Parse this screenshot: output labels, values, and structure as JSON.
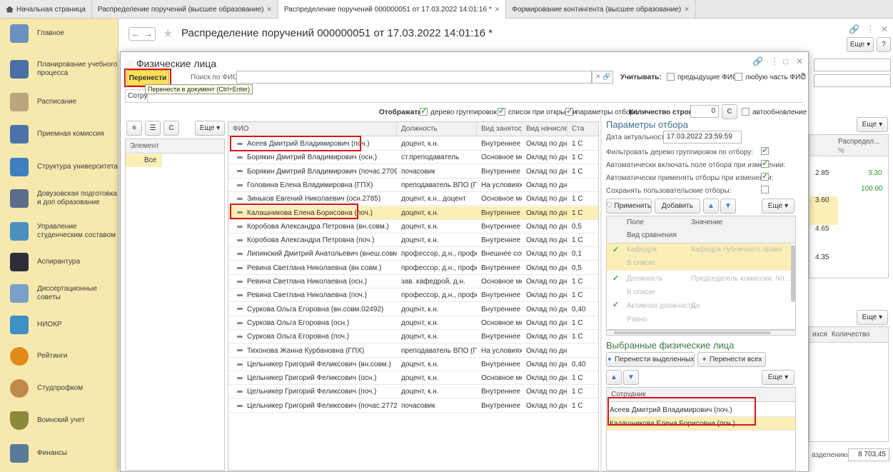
{
  "tabs": [
    {
      "label": "Начальная страница",
      "closable": false,
      "home": true
    },
    {
      "label": "Распределение поручений (высшее образование)",
      "closable": true
    },
    {
      "label": "Распределение поручений 000000051 от 17.03.2022 14:01:16 *",
      "closable": true,
      "active": true
    },
    {
      "label": "Формирование контингента (высшее образование)",
      "closable": true
    }
  ],
  "sidebar": {
    "items": [
      {
        "label": "Главное",
        "icon": "desk-icon",
        "color": "#6b8fbf"
      },
      {
        "label": "Планирование учебного процесса",
        "icon": "planner-icon",
        "color": "#4a6fa5"
      },
      {
        "label": "Расписание",
        "icon": "schedule-icon",
        "color": "#9b8a6a"
      },
      {
        "label": "Приемная комиссия",
        "icon": "admission-icon",
        "color": "#4a74a8"
      },
      {
        "label": "Структура университета",
        "icon": "structure-icon",
        "color": "#3f7fbf"
      },
      {
        "label": "Довузовская подготовка и доп образование",
        "icon": "preparation-icon",
        "color": "#5a6c8a"
      },
      {
        "label": "Управление студенческим составом",
        "icon": "students-icon",
        "color": "#4a90c0"
      },
      {
        "label": "Аспирантура",
        "icon": "graduation-icon",
        "color": "#2e2e3a"
      },
      {
        "label": "Диссертационные советы",
        "icon": "dissertation-icon",
        "color": "#7aa0c8"
      },
      {
        "label": "НИОКР",
        "icon": "research-icon",
        "color": "#3d8fc4"
      },
      {
        "label": "Рейтинги",
        "icon": "rating-icon",
        "color": "#e08a1a"
      },
      {
        "label": "Студпрофком",
        "icon": "union-icon",
        "color": "#c08a4a"
      },
      {
        "label": "Воинский учет",
        "icon": "military-icon",
        "color": "#8a8a3a"
      },
      {
        "label": "Финансы",
        "icon": "calculator-icon",
        "color": "#5a7a9a"
      }
    ]
  },
  "doc": {
    "title": "Распределение поручений 000000051 от 17.03.2022 14:01:16 *",
    "more_label": "Еще",
    "help_label": "?",
    "bg_values": [
      "2.85",
      "3.30",
      "100.00",
      "3.60",
      "4.65",
      "4.35"
    ],
    "bg_col_header": "Распредел...",
    "bg_col_unit": "%",
    "bg_col_students": "ихся",
    "bg_col_count": "Количество",
    "bg_total_label": "азделению:",
    "bg_total_value": "8 703,45"
  },
  "modal": {
    "title": "Физические лица",
    "move_btn": "Перенести",
    "tooltip": "Перенести в документ (Ctrl+Enter)",
    "search_label": "Поиск по ФИО:",
    "search_value": "",
    "consider_label": "Учитывать:",
    "opt_prev_fio": "предыдущие ФИО",
    "opt_any_part": "любую часть ФИО",
    "tab_employees": "Сотру",
    "display_label": "Отображать:",
    "opt_tree": "дерево группировок",
    "opt_list_open": "список при открытии",
    "opt_filter_params": "параметры отбора",
    "row_count_label": "Количество строк:",
    "row_count_value": "0",
    "opt_autorefresh": "автообновление",
    "more_label": "Еще",
    "tree": {
      "header": "Элемент",
      "items": [
        "Все"
      ]
    },
    "grid": {
      "columns": [
        "ФИО",
        "Должность",
        "Вид занятости",
        "Вид начислен...",
        "Ста"
      ],
      "rows": [
        {
          "fio": "Асеев Дмитрий Владимирович (поч.)",
          "pos": "доцент, к.н.",
          "emp": "Внутреннее с...",
          "acc": "Оклад по дням",
          "rate": "1 С"
        },
        {
          "fio": "Борякин Дмитрий Владимирович (осн.)",
          "pos": "ст.преподаватель",
          "emp": "Основное ме...",
          "acc": "Оклад по дням",
          "rate": "1 С"
        },
        {
          "fio": "Борякин Дмитрий Владимирович (почас.2709)",
          "pos": "почасовик",
          "emp": "Внутреннее с...",
          "acc": "Оклад по дням",
          "rate": "1 С"
        },
        {
          "fio": "Головина Елена Владимировна (ГПХ)",
          "pos": "преподаватель ВПО (ГПХ)",
          "emp": "На условиях ...",
          "acc": "Оклад по дням",
          "rate": ""
        },
        {
          "fio": "Зиньков Евгений Николаевич (осн.2785)",
          "pos": "доцент, к.н., доцент",
          "emp": "Основное ме...",
          "acc": "Оклад по дням",
          "rate": "1 С"
        },
        {
          "fio": "Калашникова Елена Борисовна (поч.)",
          "pos": "доцент, к.н.",
          "emp": "Внутреннее с...",
          "acc": "Оклад по дням",
          "rate": "1 С"
        },
        {
          "fio": "Коробова Александра Петровна (вн.совм.)",
          "pos": "доцент, к.н.",
          "emp": "Внутреннее с...",
          "acc": "Оклад по дням",
          "rate": "0,5"
        },
        {
          "fio": "Коробова Александра Петровна (поч.)",
          "pos": "доцент, к.н.",
          "emp": "Внутреннее с...",
          "acc": "Оклад по дням",
          "rate": "1 С"
        },
        {
          "fio": "Липинский Дмитрий Анатольевич (внеш.совм.)",
          "pos": "профессор, д.н., профе...",
          "emp": "Внешнее сов...",
          "acc": "Оклад по дням",
          "rate": "0,1"
        },
        {
          "fio": "Ревина Светлана Николаевна (вн.совм.)",
          "pos": "профессор, д.н., профе...",
          "emp": "Внутреннее с...",
          "acc": "Оклад по дням",
          "rate": "0,5"
        },
        {
          "fio": "Ревина Светлана Николаевна (осн.)",
          "pos": "зав. кафедрой, д.н.",
          "emp": "Основное ме...",
          "acc": "Оклад по дням",
          "rate": "1 С"
        },
        {
          "fio": "Ревина Светлана Николаевна (поч.)",
          "pos": "профессор, д.н., профе...",
          "emp": "Внутреннее с...",
          "acc": "Оклад по дням",
          "rate": "1 С"
        },
        {
          "fio": "Суркова Ольга Егоровна (вн.совм.02492)",
          "pos": "доцент, к.н.",
          "emp": "Внутреннее с...",
          "acc": "Оклад по дням",
          "rate": "0,40"
        },
        {
          "fio": "Суркова Ольга Егоровна (осн.)",
          "pos": "доцент, к.н.",
          "emp": "Основное ме...",
          "acc": "Оклад по дням",
          "rate": "1 С"
        },
        {
          "fio": "Суркова Ольга Егоровна (поч.)",
          "pos": "доцент, к.н.",
          "emp": "Внутреннее с...",
          "acc": "Оклад по дням",
          "rate": "1 С"
        },
        {
          "fio": "Тихонова Жанна Курбановна (ГПХ)",
          "pos": "преподаватель ВПО (ГПХ)",
          "emp": "На условиях ...",
          "acc": "Оклад по дням",
          "rate": ""
        },
        {
          "fio": "Цельникер Григорий Феликсович (вн.совм.)",
          "pos": "доцент, к.н.",
          "emp": "Внутреннее с...",
          "acc": "Оклад по дням",
          "rate": "0,40"
        },
        {
          "fio": "Цельникер Григорий Феликсович (осн.)",
          "pos": "доцент, к.н.",
          "emp": "Основное ме...",
          "acc": "Оклад по дням",
          "rate": "1 С"
        },
        {
          "fio": "Цельникер Григорий Феликсович (поч.)",
          "pos": "доцент, к.н.",
          "emp": "Внутреннее с...",
          "acc": "Оклад по дням",
          "rate": "1 С"
        },
        {
          "fio": "Цельникер Григорий Феликсович (почас.2772)",
          "pos": "почасовик",
          "emp": "Внутреннее с...",
          "acc": "Оклад по дням",
          "rate": "1 С"
        }
      ]
    },
    "filter": {
      "title": "Параметры отбора",
      "date_label": "Дата актуальности:",
      "date_value": "17.03.2022 23:59:59",
      "opt_filter_tree": "Фильтровать дерево группировок по отбору:",
      "opt_auto_include": "Автоматически включать поле отбора при изменении:",
      "opt_auto_apply": "Автоматически применять отборы при изменении:",
      "opt_save": "Сохранять пользовательские отборы:",
      "apply_btn": "Применить",
      "add_btn": "Добавить",
      "more_label": "Еще",
      "col_field": "Поле",
      "col_value": "Значение",
      "compare_label": "Вид сравнения",
      "rows": [
        {
          "field": "Кафедра",
          "value": "Кафедра публичного права",
          "cmp": "В списке"
        },
        {
          "field": "Должность",
          "value": "Председатель комиссии; Чл...",
          "cmp": "В списке"
        },
        {
          "field": "Активная должность",
          "value": "Да",
          "cmp": "Равно"
        }
      ]
    },
    "selected": {
      "title": "Выбранные физические лица",
      "move_selected": "Перенести выделенных",
      "move_all": "Перенести всех",
      "more_label": "Еще",
      "header": "Сотрудник",
      "rows": [
        "Асеев Дмитрий Владимирович (поч.)",
        "Калашникова Елена Борисовна (поч.)"
      ]
    }
  }
}
